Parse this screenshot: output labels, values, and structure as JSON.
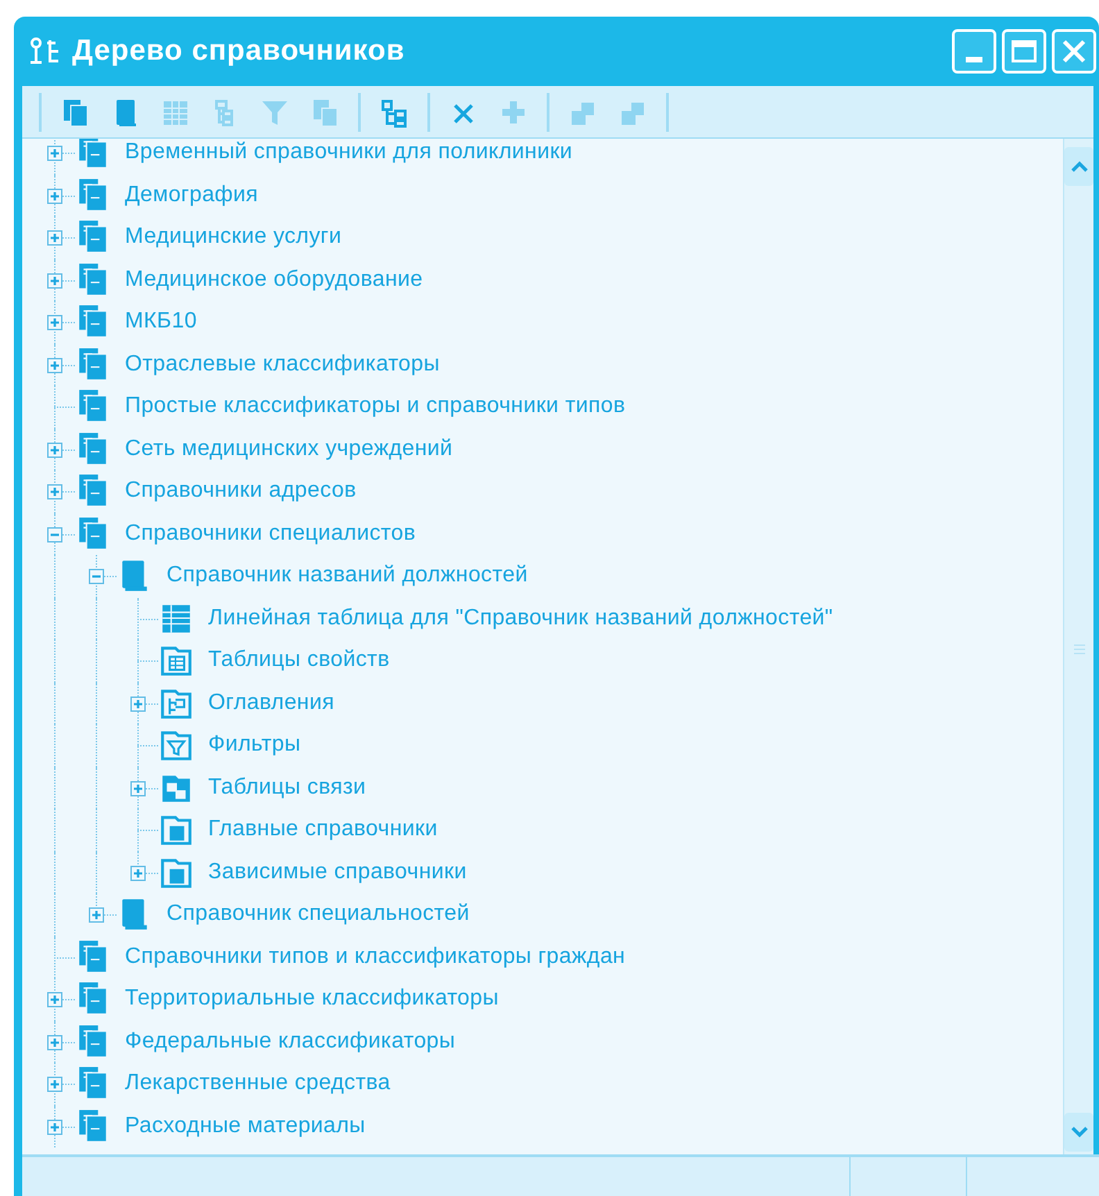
{
  "window": {
    "title": "Дерево справочников"
  },
  "toolbar": [
    {
      "kind": "copy",
      "disabled": false
    },
    {
      "kind": "book",
      "disabled": false
    },
    {
      "kind": "table",
      "disabled": true
    },
    {
      "kind": "tree",
      "disabled": true
    },
    {
      "kind": "filter",
      "disabled": true
    },
    {
      "kind": "docs",
      "disabled": true
    },
    {
      "kind": "separator"
    },
    {
      "kind": "link",
      "disabled": false
    },
    {
      "kind": "separator"
    },
    {
      "kind": "delete",
      "disabled": false
    },
    {
      "kind": "add",
      "disabled": true
    },
    {
      "kind": "separator"
    },
    {
      "kind": "piece",
      "disabled": true
    },
    {
      "kind": "piece",
      "disabled": true
    },
    {
      "kind": "separator"
    }
  ],
  "tree": [
    {
      "label": "Временный справочники для поликлиники",
      "kind": "books",
      "expanded": false
    },
    {
      "label": "Демография",
      "kind": "books",
      "expanded": false
    },
    {
      "label": "Медицинские услуги",
      "kind": "books",
      "expanded": false
    },
    {
      "label": "Медицинское оборудование",
      "kind": "books",
      "expanded": false
    },
    {
      "label": "МКБ10",
      "kind": "books",
      "expanded": false
    },
    {
      "label": "Отраслевые классификаторы",
      "kind": "books",
      "expanded": false
    },
    {
      "label": "Простые классификаторы и справочники типов",
      "kind": "books"
    },
    {
      "label": "Сеть медицинских учреждений",
      "kind": "books",
      "expanded": false
    },
    {
      "label": "Справочники адресов",
      "kind": "books",
      "expanded": false
    },
    {
      "label": "Справочники специалистов",
      "kind": "books",
      "expanded": true,
      "children": [
        {
          "label": "Справочник названий должностей",
          "kind": "book",
          "expanded": true,
          "children": [
            {
              "label": "Линейная таблица для \"Справочник названий должностей\"",
              "kind": "table"
            },
            {
              "label": "Таблицы свойств",
              "kind": "folder-table"
            },
            {
              "label": "Оглавления",
              "kind": "folder-tree",
              "expanded": false
            },
            {
              "label": "Фильтры",
              "kind": "folder-filter"
            },
            {
              "label": "Таблицы связи",
              "kind": "folder-link",
              "expanded": false
            },
            {
              "label": "Главные справочники",
              "kind": "folder"
            },
            {
              "label": "Зависимые справочники",
              "kind": "folder",
              "expanded": false
            }
          ]
        },
        {
          "label": "Справочник специальностей",
          "kind": "book",
          "expanded": false
        }
      ]
    },
    {
      "label": "Справочники типов и классификаторы граждан",
      "kind": "books"
    },
    {
      "label": "Территориальные классификаторы",
      "kind": "books",
      "expanded": false
    },
    {
      "label": "Федеральные классификаторы",
      "kind": "books",
      "expanded": false
    },
    {
      "label": "Лекарственные средства",
      "kind": "books",
      "expanded": false
    },
    {
      "label": "Расходные материалы",
      "kind": "books",
      "expanded": false
    }
  ]
}
